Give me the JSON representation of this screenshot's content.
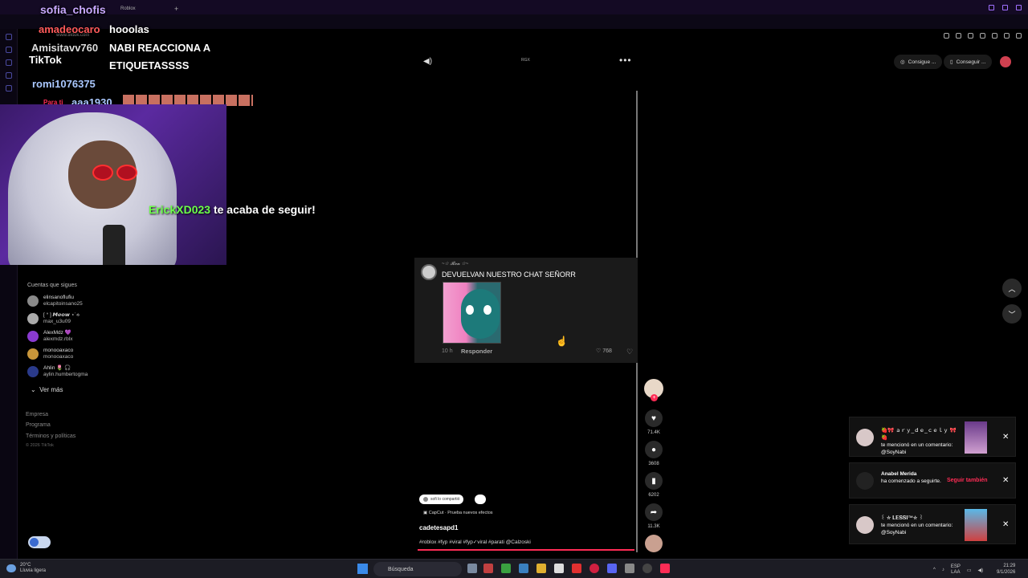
{
  "browser": {
    "tab1": "Roblox",
    "url": "www.tiktok.com"
  },
  "overlay": {
    "chat": [
      {
        "user": "sofia_chofis",
        "msg": ""
      },
      {
        "user": "amadeocaro",
        "msg": "hooolas"
      },
      {
        "user": "Amisitavv760",
        "msg": "NABI REACCIONA A"
      },
      {
        "user": "",
        "msg": "ETIQUETASSSS"
      },
      {
        "user": "romi1076375",
        "msg": ""
      },
      {
        "user": "aaa1930",
        "msg": ""
      }
    ],
    "tiktok_logo": "TikTok",
    "para_ti": "Para ti",
    "follow_alert": {
      "name": "ErickXD023",
      "text": " te acaba de seguir!"
    }
  },
  "sidebar": {
    "title": "Cuentas que sigues",
    "following": [
      {
        "name": "elinsanoflufiu",
        "user": "elcapitoinsano25"
      },
      {
        "name": "[ ᐢ ] 𝙈𝙚𝙤𝙬 ⋆˙⟡",
        "user": "max_u3u09"
      },
      {
        "name": "AlexMdz 💜",
        "user": "alexmdz.rblx"
      },
      {
        "name": "monooaxaco",
        "user": "monooaxaco"
      },
      {
        "name": "Ahlin 🌷 🎧",
        "user": "aylin.humbertogma"
      }
    ],
    "see_more": "Ver más",
    "footer": [
      "Empresa",
      "Programa",
      "Términos y políticas"
    ],
    "copyright": "© 2026 TikTok"
  },
  "video": {
    "rgx": "RGX",
    "promo1": "Consigue ...",
    "promo2": "Conseguir ..."
  },
  "comment": {
    "user": "~☆ 𝓡𝓮𝓷 ☆~",
    "text": "DEVUELVAN NUESTRO CHAT SEÑORR",
    "time": "10 h",
    "reply": "Responder",
    "likes": "768"
  },
  "actions": {
    "likes": "71.4K",
    "comments": "3608",
    "saves": "6202",
    "shares": "11.3K"
  },
  "caption": {
    "shared": "sofi lo compartió",
    "capcut": "CapCut · Prueba nuevos efectos",
    "author": "cadetesapd1",
    "hashtags": "#roblox #fyp #viral #fyp✓viral #parati @Calzoski"
  },
  "notifications": [
    {
      "user": "🍓🎀 ａｒｙ_ｄｅ_ｃｅｌｙ 🎀🍓",
      "text": "te mencionó en un comentario: @SoyNabi"
    },
    {
      "user": "Anabel Merida",
      "text": "ha comenzado a seguirte.",
      "action": "Seguir también"
    },
    {
      "user": "꒰ ✮ 𝐋𝐄𝐒𝐒𝐈™✮ ꒱",
      "text": "te mencionó en un comentario: @SoyNabi"
    }
  ],
  "taskbar": {
    "temp": "20°C",
    "weather": "Lluvia ligera",
    "search": "Búsqueda",
    "lang1": "ESP",
    "lang2": "LAA",
    "time": "21:29",
    "date": "9/1/2026"
  },
  "colors": {
    "accent": "#fe2c55",
    "follow_green": "#6cff4a",
    "purple_ui": "#a070ff"
  }
}
